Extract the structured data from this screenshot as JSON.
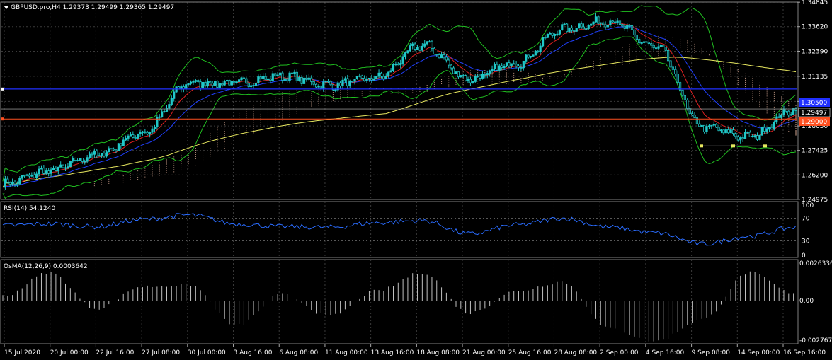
{
  "symbol_header": "GBPUSD.pro,H4  1.29373 1.29499 1.29365 1.29497",
  "rsi_header": "RSI(14) 54.1240",
  "osma_header": "OsMA(12,26,9) 0.0003642",
  "price_badges": {
    "bid": "1.29497",
    "level": "1.29000",
    "blue_line": "1.30500"
  },
  "colors": {
    "background": "#000000",
    "grid": "#3a3a3a",
    "candle": "#20c8c8",
    "bollinger": "#20c020",
    "ema_fast": "#e02020",
    "ema_slow": "#2040ff",
    "sma_long": "#e8e860",
    "ichimoku": "#e8b8a0",
    "rsi_line": "#2a6cff",
    "osma_bars": "#c0c0c0",
    "horizontal_blue": "#2030ff",
    "horizontal_orange": "#ff5020",
    "support_line": "#d0d0d0"
  },
  "chart_data": [
    {
      "type": "candlestick",
      "title": "GBPUSD.pro,H4",
      "y_ticks": [
        "1.34845",
        "1.33620",
        "1.32390",
        "1.31135",
        "1.29880",
        "1.28650",
        "1.27425",
        "1.26200",
        "1.24975"
      ],
      "ylim": [
        1.2497,
        1.3485
      ],
      "x_ticks": [
        "15 Jul 2020",
        "20 Jul 00:00",
        "22 Jul 16:00",
        "27 Jul 08:00",
        "30 Jul 00:00",
        "3 Aug 16:00",
        "6 Aug 08:00",
        "11 Aug 00:00",
        "13 Aug 16:00",
        "18 Aug 08:00",
        "21 Aug 00:00",
        "25 Aug 16:00",
        "28 Aug 08:00",
        "2 Sep 00:00",
        "4 Sep 16:00",
        "9 Sep 08:00",
        "14 Sep 00:00",
        "16 Sep 16:00"
      ],
      "close_anchors": [
        {
          "x": "15 Jul 2020",
          "y": 1.2575
        },
        {
          "x": "20 Jul 00:00",
          "y": 1.264
        },
        {
          "x": "22 Jul 16:00",
          "y": 1.272
        },
        {
          "x": "27 Jul 08:00",
          "y": 1.283
        },
        {
          "x": "30 Jul 00:00",
          "y": 1.308
        },
        {
          "x": "3 Aug 16:00",
          "y": 1.308
        },
        {
          "x": "6 Aug 08:00",
          "y": 1.3115
        },
        {
          "x": "11 Aug 00:00",
          "y": 1.307
        },
        {
          "x": "13 Aug 16:00",
          "y": 1.3105
        },
        {
          "x": "18 Aug 08:00",
          "y": 1.327
        },
        {
          "x": "21 Aug 00:00",
          "y": 1.31
        },
        {
          "x": "25 Aug 16:00",
          "y": 1.318
        },
        {
          "x": "28 Aug 08:00",
          "y": 1.335
        },
        {
          "x": "2 Sep 00:00",
          "y": 1.339
        },
        {
          "x": "4 Sep 16:00",
          "y": 1.326
        },
        {
          "x": "9 Sep 08:00",
          "y": 1.286
        },
        {
          "x": "14 Sep 00:00",
          "y": 1.281
        },
        {
          "x": "16 Sep 16:00",
          "y": 1.295
        }
      ],
      "horizontal_lines": [
        1.305,
        1.295,
        1.29
      ],
      "support_line": 1.2765
    },
    {
      "type": "line",
      "title": "RSI(14) 54.1240",
      "y_ticks": [
        "100",
        "70",
        "30",
        "0"
      ],
      "ylim": [
        0,
        100
      ],
      "levels": [
        70,
        30
      ],
      "anchors": [
        {
          "x": "15 Jul 2020",
          "y": 57
        },
        {
          "x": "20 Jul 00:00",
          "y": 60
        },
        {
          "x": "22 Jul 16:00",
          "y": 55
        },
        {
          "x": "27 Jul 08:00",
          "y": 68
        },
        {
          "x": "30 Jul 00:00",
          "y": 76
        },
        {
          "x": "3 Aug 16:00",
          "y": 60
        },
        {
          "x": "6 Aug 08:00",
          "y": 55
        },
        {
          "x": "11 Aug 00:00",
          "y": 54
        },
        {
          "x": "13 Aug 16:00",
          "y": 62
        },
        {
          "x": "18 Aug 08:00",
          "y": 66
        },
        {
          "x": "21 Aug 00:00",
          "y": 42
        },
        {
          "x": "25 Aug 16:00",
          "y": 58
        },
        {
          "x": "28 Aug 08:00",
          "y": 70
        },
        {
          "x": "2 Sep 00:00",
          "y": 54
        },
        {
          "x": "4 Sep 16:00",
          "y": 44
        },
        {
          "x": "9 Sep 08:00",
          "y": 24
        },
        {
          "x": "14 Sep 00:00",
          "y": 38
        },
        {
          "x": "16 Sep 16:00",
          "y": 54
        }
      ]
    },
    {
      "type": "bar",
      "title": "OsMA(12,26,9) 0.0003642",
      "y_ticks": [
        "0.0026336",
        "0.00",
        "-0.0027672"
      ],
      "ylim": [
        -0.0027672,
        0.0026336
      ],
      "anchors": [
        {
          "x": "15 Jul 2020",
          "y": 0.0003
        },
        {
          "x": "20 Jul 00:00",
          "y": 0.0018
        },
        {
          "x": "22 Jul 16:00",
          "y": -0.0005
        },
        {
          "x": "27 Jul 08:00",
          "y": 0.0009
        },
        {
          "x": "30 Jul 00:00",
          "y": 0.001
        },
        {
          "x": "3 Aug 16:00",
          "y": -0.0016
        },
        {
          "x": "6 Aug 08:00",
          "y": 0.0004
        },
        {
          "x": "11 Aug 00:00",
          "y": -0.001
        },
        {
          "x": "13 Aug 16:00",
          "y": 0.0006
        },
        {
          "x": "18 Aug 08:00",
          "y": 0.0018
        },
        {
          "x": "21 Aug 00:00",
          "y": -0.0008
        },
        {
          "x": "25 Aug 16:00",
          "y": 0.0006
        },
        {
          "x": "28 Aug 08:00",
          "y": 0.0012
        },
        {
          "x": "2 Sep 00:00",
          "y": -0.0018
        },
        {
          "x": "4 Sep 16:00",
          "y": -0.0026
        },
        {
          "x": "9 Sep 08:00",
          "y": -0.0012
        },
        {
          "x": "14 Sep 00:00",
          "y": 0.0018
        },
        {
          "x": "16 Sep 16:00",
          "y": 0.0004
        }
      ]
    }
  ]
}
